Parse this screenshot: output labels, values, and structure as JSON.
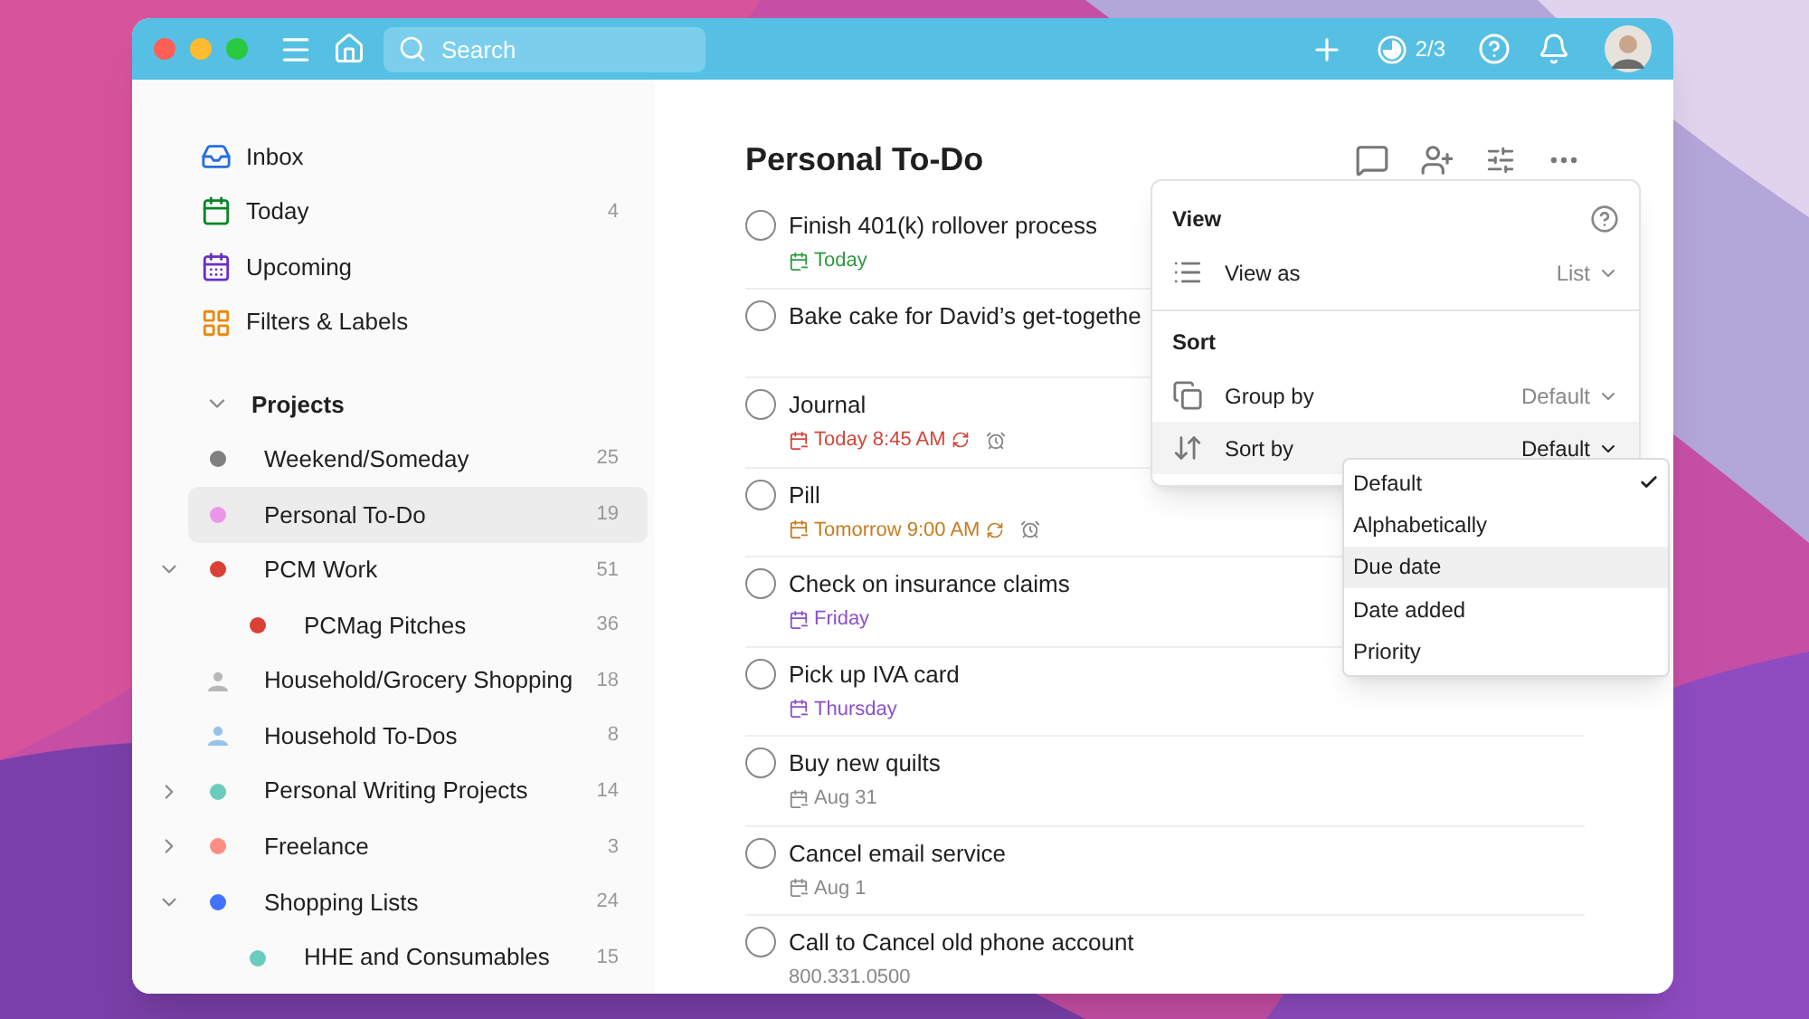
{
  "toolbar": {
    "search": {
      "placeholder": "Search"
    },
    "karma": "2/3"
  },
  "sidebar": {
    "items": [
      {
        "kind": "inbox",
        "label": "Inbox",
        "selected": false
      },
      {
        "kind": "today",
        "label": "Today",
        "count": "4",
        "selected": false
      },
      {
        "kind": "upcoming",
        "label": "Upcoming",
        "selected": false
      },
      {
        "kind": "filters",
        "label": "Filters & Labels",
        "selected": false
      }
    ],
    "projects_header": {
      "label": "Projects",
      "expanded": true
    },
    "projects": [
      {
        "kind": "dot",
        "label": "Weekend/Someday",
        "count": "25",
        "color": "#808080",
        "selected": false
      },
      {
        "kind": "dot",
        "label": "Personal To-Do",
        "count": "19",
        "color": "#eb96eb",
        "selected": true
      },
      {
        "kind": "dot",
        "label": "PCM Work",
        "count": "51",
        "color": "#db4035",
        "selected": false,
        "expanded": true,
        "children": [
          {
            "kind": "dot",
            "label": "PCMag Pitches",
            "count": "36",
            "color": "#db4035",
            "selected": false
          }
        ]
      },
      {
        "kind": "person",
        "label": "Household/Grocery Shopping",
        "count": "18",
        "color": "#b8b8b8",
        "selected": false
      },
      {
        "kind": "person",
        "label": "Household To-Dos",
        "count": "8",
        "color": "#96c3eb",
        "selected": false
      },
      {
        "kind": "dot",
        "label": "Personal Writing Projects",
        "count": "14",
        "color": "#6accbc",
        "selected": false,
        "expanded": false
      },
      {
        "kind": "dot",
        "label": "Freelance",
        "count": "3",
        "color": "#ff8d85",
        "selected": false,
        "expanded": false
      },
      {
        "kind": "dot",
        "label": "Shopping Lists",
        "count": "24",
        "color": "#4073ff",
        "selected": false,
        "expanded": true,
        "children": [
          {
            "kind": "dot",
            "label": "HHE and Consumables",
            "count": "15",
            "color": "#6accbc",
            "selected": false
          }
        ]
      }
    ]
  },
  "main": {
    "title": "Personal To-Do",
    "tasks": [
      {
        "title": "Finish 401(k) rollover process",
        "checked": false,
        "due": {
          "text": "Today",
          "color": "#2e9a3f"
        }
      },
      {
        "title": "Bake cake for David’s get-togethe",
        "checked": false
      },
      {
        "title": "Journal",
        "checked": false,
        "due": {
          "text": "Today 8:45 AM",
          "color": "#d1453b",
          "recurring": true,
          "reminder": true
        }
      },
      {
        "title": "Pill",
        "checked": false,
        "due": {
          "text": "Tomorrow 9:00 AM",
          "color": "#c77c1f",
          "recurring": true,
          "reminder": true
        }
      },
      {
        "title": "Check on insurance claims",
        "checked": false,
        "due": {
          "text": "Friday",
          "color": "#8a4fd0"
        }
      },
      {
        "title": "Pick up IVA card",
        "checked": false,
        "due": {
          "text": "Thursday",
          "color": "#8a4fd0"
        }
      },
      {
        "title": "Buy new quilts",
        "checked": false,
        "due": {
          "text": "Aug 31",
          "color": "#8a8a8a"
        }
      },
      {
        "title": "Cancel email service",
        "checked": false,
        "due": {
          "text": "Aug 1",
          "color": "#8a8a8a"
        }
      },
      {
        "title": "Call to Cancel old phone account",
        "checked": false,
        "description": "800.331.0500"
      }
    ]
  },
  "view_menu": {
    "sections": [
      {
        "title": "View",
        "rows": [
          {
            "kind": "view",
            "label": "View as",
            "value": "List",
            "hovered": false
          }
        ]
      },
      {
        "title": "Sort",
        "rows": [
          {
            "kind": "group",
            "label": "Group by",
            "value": "Default",
            "hovered": false
          },
          {
            "kind": "sort",
            "label": "Sort by",
            "value": "Default",
            "hovered": true
          }
        ]
      }
    ]
  },
  "sort_options": [
    {
      "label": "Default",
      "checked": true,
      "hovered": false
    },
    {
      "label": "Alphabetically",
      "checked": false,
      "hovered": false
    },
    {
      "label": "Due date",
      "checked": false,
      "hovered": true
    },
    {
      "label": "Date added",
      "checked": false,
      "hovered": false
    },
    {
      "label": "Priority",
      "checked": false,
      "hovered": false
    }
  ]
}
